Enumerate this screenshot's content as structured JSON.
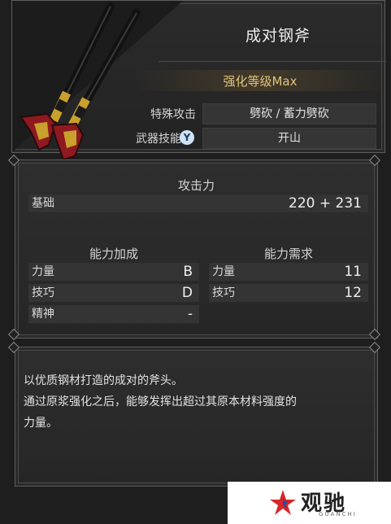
{
  "weapon": {
    "title": "成对钢斧",
    "upgrade_level": "强化等级Max",
    "special_attack_label": "特殊攻击",
    "special_attack_value": "劈砍 / 蓄力劈砍",
    "weapon_skill_label": "武器技能",
    "weapon_skill_button": "Y",
    "weapon_skill_value": "开山"
  },
  "stats": {
    "attack_header": "攻击力",
    "base_label": "基础",
    "base_value": "220 + 231",
    "scaling_header": "能力加成",
    "requirements_header": "能力需求",
    "scaling": [
      {
        "label": "力量",
        "value": "B"
      },
      {
        "label": "技巧",
        "value": "D"
      },
      {
        "label": "精神",
        "value": "-"
      }
    ],
    "requirements": [
      {
        "label": "力量",
        "value": "11"
      },
      {
        "label": "技巧",
        "value": "12"
      }
    ]
  },
  "description": {
    "line1": "以优质钢材打造的成对的斧头。",
    "line2": "通过原浆强化之后，能够发挥出超过其原本材料强度的",
    "line3": "力量。"
  },
  "watermark": {
    "text": "观驰",
    "sub": "GUANCHI"
  },
  "colors": {
    "gold_text": "#e2c37a",
    "y_button": "#cfe3f6",
    "weapon_red": "#8e1a20",
    "weapon_gold": "#c9a02c"
  }
}
